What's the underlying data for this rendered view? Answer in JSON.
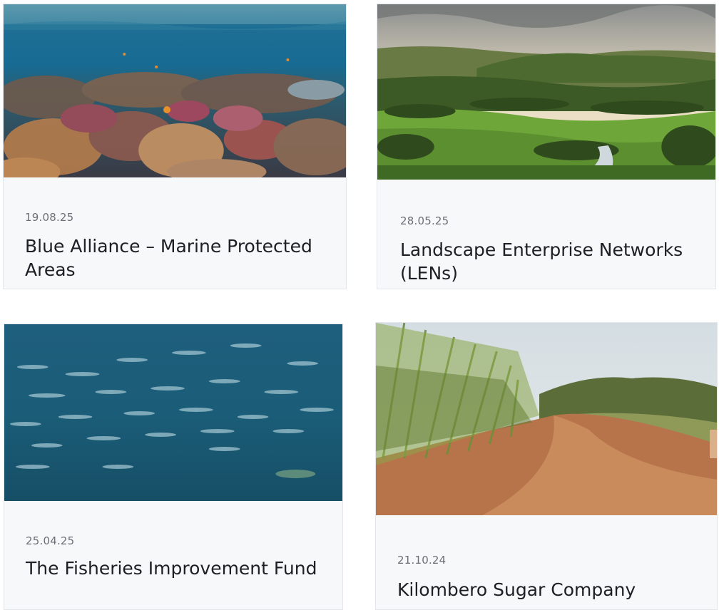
{
  "cards": [
    {
      "date": "19.08.25",
      "title": "Blue Alliance – Marine Protected Areas",
      "image": "coral-reef-photo"
    },
    {
      "date": "28.05.25",
      "title": "Landscape Enterprise Networks (LENs)",
      "image": "green-valley-landscape-photo"
    },
    {
      "date": "25.04.25",
      "title": "The Fisheries Improvement Fund",
      "image": "fish-shoal-photo"
    },
    {
      "date": "21.10.24",
      "title": "Kilombero Sugar Company",
      "image": "sugarcane-dirt-road-photo"
    }
  ]
}
